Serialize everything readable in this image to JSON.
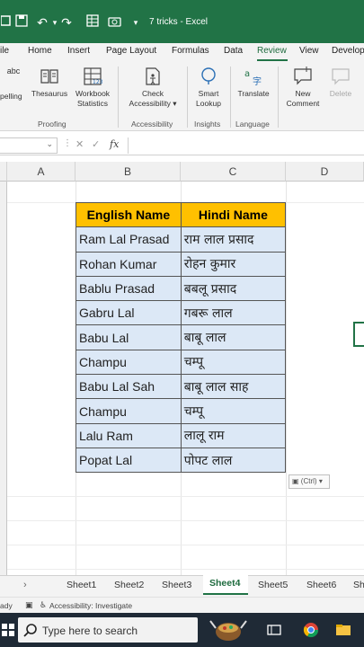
{
  "window": {
    "title": "7 tricks - Excel"
  },
  "ribbon_tabs": [
    {
      "label": "ile"
    },
    {
      "label": "Home"
    },
    {
      "label": "Insert"
    },
    {
      "label": "Page Layout"
    },
    {
      "label": "Formulas"
    },
    {
      "label": "Data"
    },
    {
      "label": "Review"
    },
    {
      "label": "View"
    },
    {
      "label": "Develop"
    }
  ],
  "active_tab": "Review",
  "ribbon": {
    "spelling": "pelling",
    "thesaurus": "Thesaurus",
    "workbook_stats_line1": "Workbook",
    "workbook_stats_line2": "Statistics",
    "check_acc_line1": "Check",
    "check_acc_line2": "Accessibility",
    "smart_lookup_line1": "Smart",
    "smart_lookup_line2": "Lookup",
    "translate": "Translate",
    "new_comment_line1": "New",
    "new_comment_line2": "Comment",
    "delete": "Delete",
    "abc": "abc",
    "groups": {
      "proofing": "Proofing",
      "accessibility": "Accessibility",
      "insights": "Insights",
      "language": "Language"
    }
  },
  "formula_bar": {
    "fx": "fx",
    "cancel": "✕",
    "enter": "✓"
  },
  "columns": [
    "A",
    "B",
    "C",
    "D"
  ],
  "table": {
    "headers": [
      "English Name",
      "Hindi Name"
    ],
    "rows": [
      [
        "Ram Lal Prasad",
        "राम लाल प्रसाद"
      ],
      [
        "Rohan Kumar",
        "रोहन कुमार"
      ],
      [
        "Bablu Prasad",
        "बबलू प्रसाद"
      ],
      [
        "Gabru Lal",
        "गबरू लाल"
      ],
      [
        "Babu Lal",
        "बाबू लाल"
      ],
      [
        "Champu",
        "चम्पू"
      ],
      [
        "Babu Lal Sah",
        "बाबू लाल साह"
      ],
      [
        "Champu",
        "चम्पू"
      ],
      [
        "Lalu Ram",
        "लालू राम"
      ],
      [
        "Popat Lal",
        "पोपट लाल"
      ]
    ]
  },
  "paste_options": "(Ctrl)",
  "sheets": [
    "Sheet1",
    "Sheet2",
    "Sheet3",
    "Sheet4",
    "Sheet5",
    "Sheet6",
    "Sh"
  ],
  "active_sheet": "Sheet4",
  "status": {
    "ready": "ady",
    "accessibility": "Accessibility: Investigate"
  },
  "taskbar": {
    "search_placeholder": "Type here to search"
  },
  "colors": {
    "excel_green": "#217346",
    "header_fill": "#ffc000",
    "cell_fill": "#dce8f6",
    "taskbar": "#1f2a36"
  }
}
